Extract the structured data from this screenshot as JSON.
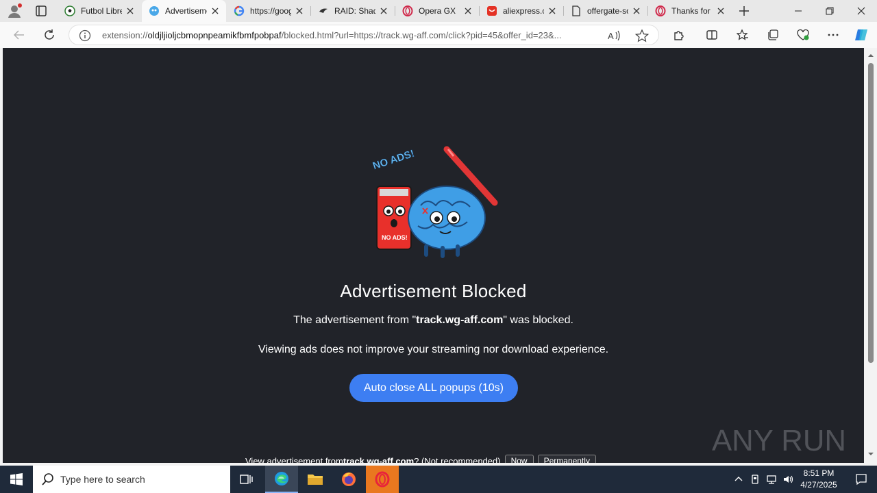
{
  "browser": {
    "tabs": [
      {
        "title": "Futbol Libre",
        "icon": "soccer-ball-icon"
      },
      {
        "title": "Advertisement Blocked",
        "icon": "brain-icon",
        "active": true
      },
      {
        "title": "https://google",
        "icon": "google-icon"
      },
      {
        "title": "RAID: Shadow Legends",
        "icon": "raid-icon"
      },
      {
        "title": "Opera GX",
        "icon": "opera-icon"
      },
      {
        "title": "aliexpress.com",
        "icon": "aliexpress-icon"
      },
      {
        "title": "offergate-software",
        "icon": "document-icon"
      },
      {
        "title": "Thanks for",
        "icon": "opera-icon"
      }
    ],
    "address": {
      "prefix": "extension://",
      "domain": "oldjljioljcbmopnpeamikfbmfpobpaf",
      "rest": "/blocked.html?url=https://track.wg-aff.com/click?pid=45&offer_id=23&..."
    }
  },
  "page": {
    "heading": "Advertisement Blocked",
    "blocked_text_before": "The advertisement from \"",
    "blocked_domain": "track.wg-aff.com",
    "blocked_text_after": "\" was blocked.",
    "note": "Viewing ads does not improve your streaming nor download experience.",
    "auto_close_button": "Auto close ALL popups (10s)",
    "view_prefix": "View advertisement from ",
    "view_domain": "track.wg-aff.com",
    "view_suffix": "? (Not recommended)",
    "now_button": "Now",
    "permanently_button": "Permanently",
    "hero_text_top": "NO ADS!",
    "hero_text_sign": "NO ADS!"
  },
  "watermark": "ANY RUN",
  "taskbar": {
    "search_placeholder": "Type here to search",
    "time": "8:51 PM",
    "date": "4/27/2025"
  },
  "colors": {
    "page_bg": "#212329",
    "accent_button": "#3d7ef2",
    "taskbar": "#1f2a3a"
  }
}
